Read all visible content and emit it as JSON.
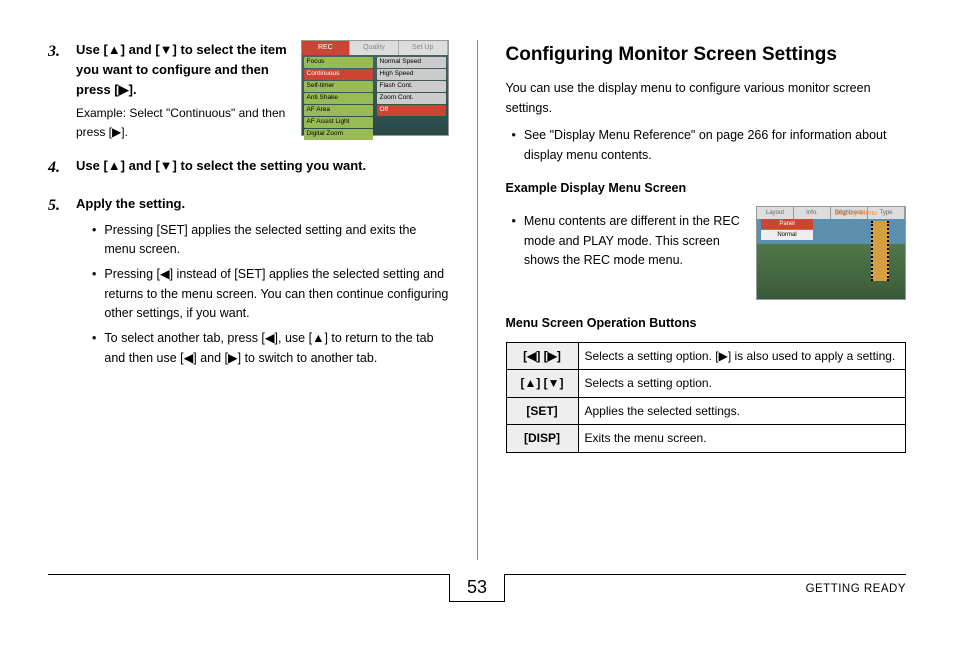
{
  "left": {
    "step3": {
      "num": "3.",
      "title_parts": [
        "Use [",
        "▲",
        "] and [",
        "▼",
        "] to select the item you want to configure and then press [",
        "▶",
        "]."
      ],
      "sub_parts": [
        "Example: Select \"Continuous\" and then press [",
        "▶",
        "]."
      ]
    },
    "thumb1": {
      "tabs": [
        "REC",
        "Quality",
        "Set Up"
      ],
      "left_items": [
        "Focus",
        "Continuous",
        "Self-timer",
        "Anti Shake",
        "AF Area",
        "AF Assist Light",
        "Digital Zoom"
      ],
      "right_items": [
        "Normal Speed",
        "High Speed",
        "Flash Cont.",
        "Zoom Cont.",
        "Off"
      ]
    },
    "step4": {
      "num": "4.",
      "title_parts": [
        "Use [",
        "▲",
        "] and [",
        "▼",
        "] to select the setting you want."
      ]
    },
    "step5": {
      "num": "5.",
      "title": "Apply the setting.",
      "bullets": [
        "Pressing [SET] applies the selected setting and exits the menu screen.",
        [
          "Pressing [",
          "◀",
          "] instead of [SET] applies the selected setting and returns to the menu screen. You can then continue configuring other settings, if you want."
        ],
        [
          "To select another tab, press [",
          "◀",
          "], use [",
          "▲",
          "] to return to the tab and then use [",
          "◀",
          "] and [",
          "▶",
          "] to switch to another tab."
        ]
      ]
    }
  },
  "right": {
    "title": "Configuring Monitor Screen Settings",
    "intro": "You can use the display menu to configure various monitor screen settings.",
    "see_ref": "See \"Display Menu Reference\" on page 266 for information about display menu contents.",
    "example_head": "Example Display Menu Screen",
    "example_text": "Menu contents are different in the REC mode and PLAY mode. This screen shows the REC mode menu.",
    "thumb2": {
      "dm_title": "Display Menu",
      "tabs": [
        "Layout",
        "Info.",
        "Brightness",
        "Type"
      ],
      "rows": [
        "Panel",
        "Normal"
      ]
    },
    "op_head": "Menu Screen Operation Buttons",
    "table": [
      {
        "key": "[◀] [▶]",
        "desc_parts": [
          "Selects a setting option. [",
          "▶",
          "] is also used to apply a setting."
        ]
      },
      {
        "key": "[▲] [▼]",
        "desc": "Selects a setting option."
      },
      {
        "key": "[SET]",
        "desc": "Applies the selected settings."
      },
      {
        "key": "[DISP]",
        "desc": "Exits the menu screen."
      }
    ]
  },
  "footer": {
    "page": "53",
    "section": "GETTING READY"
  }
}
